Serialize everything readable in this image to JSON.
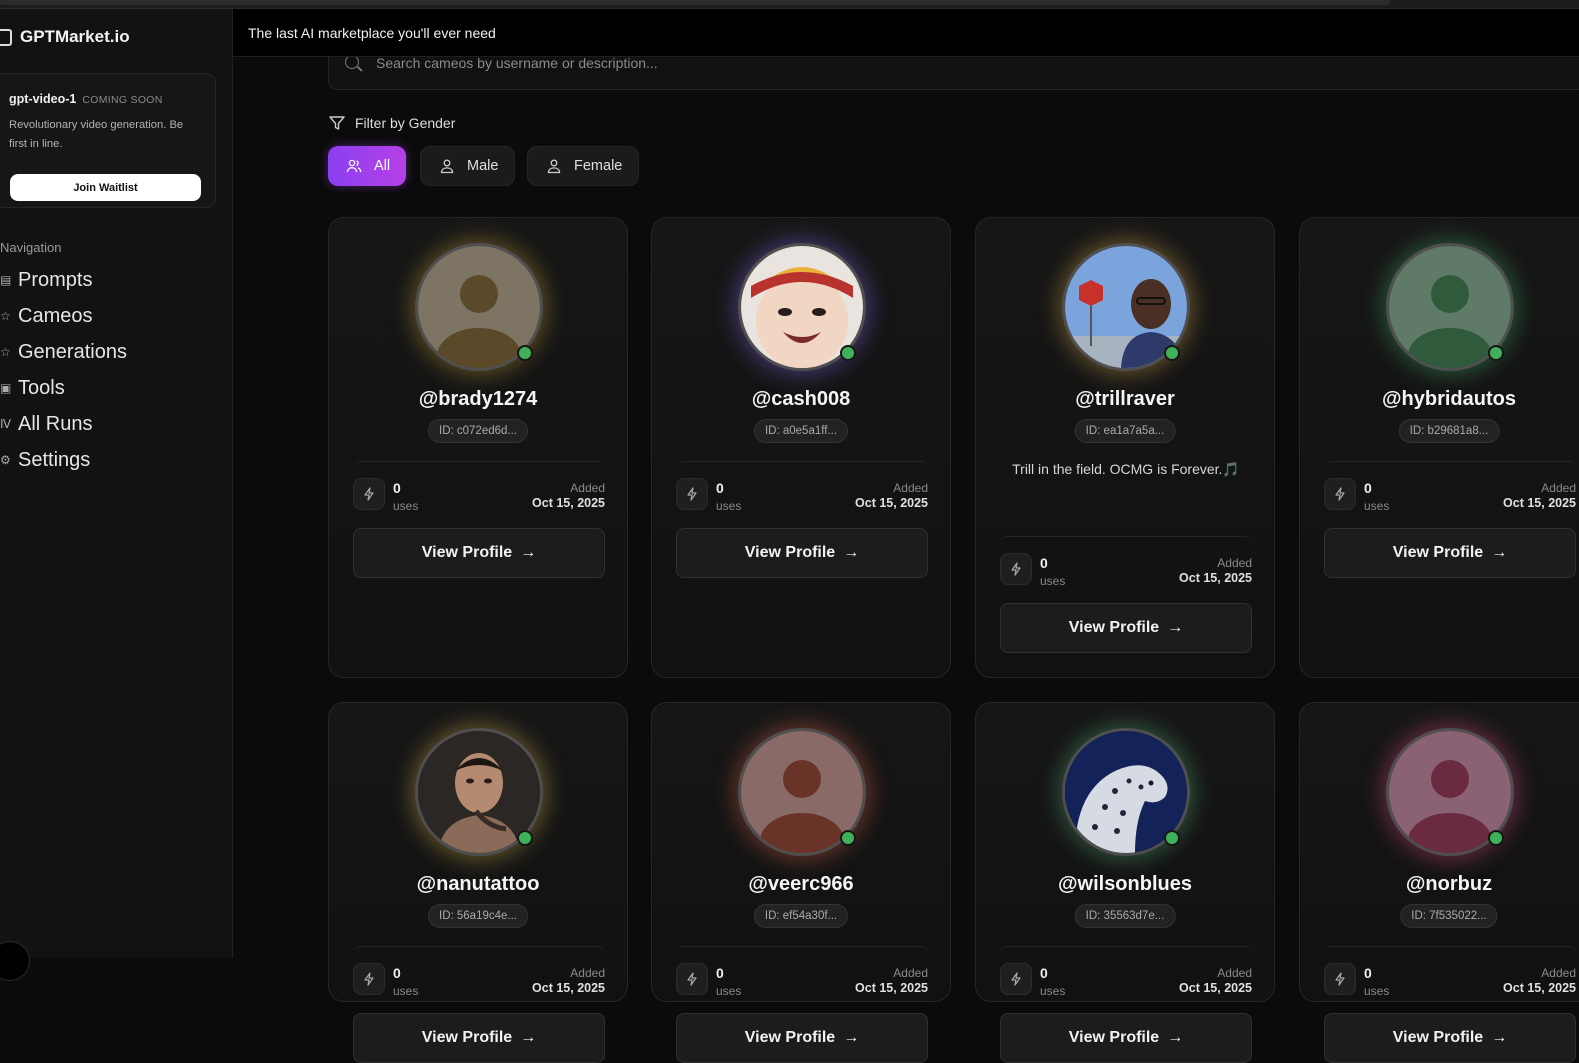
{
  "app": {
    "name": "GPTMarket.io",
    "banner": "The last AI marketplace you'll ever need"
  },
  "promo": {
    "model": "gpt-video-1",
    "badge": "COMING SOON",
    "description": "Revolutionary video generation. Be first in line.",
    "cta": "Join Waitlist"
  },
  "sidebar": {
    "section_label": "Navigation",
    "items": [
      {
        "label": "Prompts",
        "icon": "document-icon"
      },
      {
        "label": "Cameos",
        "icon": "person-icon"
      },
      {
        "label": "Generations",
        "icon": "star-icon"
      },
      {
        "label": "Tools",
        "icon": "tools-icon"
      },
      {
        "label": "All Runs",
        "icon": "runs-icon"
      },
      {
        "label": "Settings",
        "icon": "gear-icon"
      }
    ]
  },
  "search": {
    "placeholder": "Search cameos by username or description..."
  },
  "filter": {
    "label": "Filter by Gender",
    "options": [
      {
        "label": "All",
        "active": true
      },
      {
        "label": "Male",
        "active": false
      },
      {
        "label": "Female",
        "active": false
      }
    ]
  },
  "cards": [
    {
      "username": "@brady1274",
      "id": "ID: c072ed6d...",
      "uses": "0",
      "uses_label": "uses",
      "added_label": "Added",
      "added": "Oct 15, 2025",
      "button": "View Profile",
      "bio": "",
      "glow": "#c9a63a",
      "avatar": "placeholder",
      "avatar_bg": "#7d7464",
      "avatar_fg": "#5a4a2a"
    },
    {
      "username": "@cash008",
      "id": "ID: a0e5a1ff...",
      "uses": "0",
      "uses_label": "uses",
      "added_label": "Added",
      "added": "Oct 15, 2025",
      "button": "View Profile",
      "bio": "",
      "glow": "#8a6cf0",
      "avatar": "baby-photo",
      "avatar_bg": "#d9cfc6",
      "avatar_fg": "#b23a3a"
    },
    {
      "username": "@trillraver",
      "id": "ID: ea1a7a5a...",
      "uses": "0",
      "uses_label": "uses",
      "added_label": "Added",
      "added": "Oct 15, 2025",
      "button": "View Profile",
      "bio": "Trill in the field. OCMG is Forever.🎵",
      "glow": "#d6a94a",
      "avatar": "man-photo",
      "avatar_bg": "#6f9bd8",
      "avatar_fg": "#3a2b22"
    },
    {
      "username": "@hybridautos",
      "id": "ID: b29681a8...",
      "uses": "0",
      "uses_label": "uses",
      "added_label": "Added",
      "added": "Oct 15, 2025",
      "button": "View Profile",
      "bio": "",
      "glow": "#49b06a",
      "avatar": "placeholder",
      "avatar_bg": "#5f7a66",
      "avatar_fg": "#2f5a3c"
    },
    {
      "username": "@nanutattoo",
      "id": "ID: 56a19c4e...",
      "uses": "0",
      "uses_label": "uses",
      "added_label": "Added",
      "added": "Oct 15, 2025",
      "button": "View Profile",
      "bio": "",
      "glow": "#d6b44a",
      "avatar": "tattoo-photo",
      "avatar_bg": "#2a2622",
      "avatar_fg": "#b08a70"
    },
    {
      "username": "@veerc966",
      "id": "ID: ef54a30f...",
      "uses": "0",
      "uses_label": "uses",
      "added_label": "Added",
      "added": "Oct 15, 2025",
      "button": "View Profile",
      "bio": "",
      "glow": "#e0644a",
      "avatar": "placeholder",
      "avatar_bg": "#8a6a66",
      "avatar_fg": "#6a3328"
    },
    {
      "username": "@wilsonblues",
      "id": "ID: 35563d7e...",
      "uses": "0",
      "uses_label": "uses",
      "added_label": "Added",
      "added": "Oct 15, 2025",
      "button": "View Profile",
      "bio": "",
      "glow": "#5ab07a",
      "avatar": "leopard-photo",
      "avatar_bg": "#14225a",
      "avatar_fg": "#d8dce6"
    },
    {
      "username": "@norbuz",
      "id": "ID: 7f535022...",
      "uses": "0",
      "uses_label": "uses",
      "added_label": "Added",
      "added": "Oct 15, 2025",
      "button": "View Profile",
      "bio": "",
      "glow": "#e0508a",
      "avatar": "placeholder",
      "avatar_bg": "#8a6274",
      "avatar_fg": "#6a2a40"
    }
  ]
}
